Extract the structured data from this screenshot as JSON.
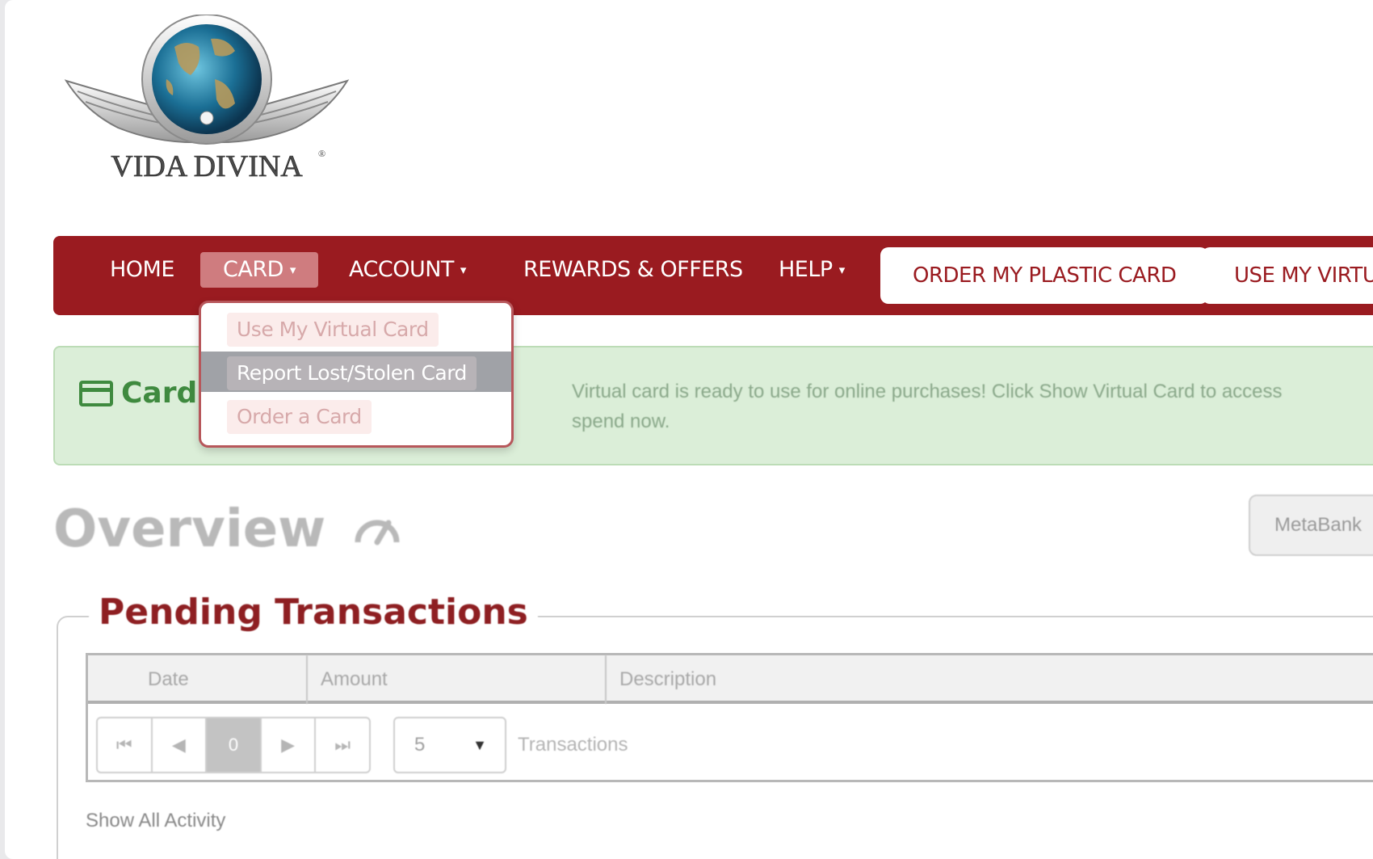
{
  "brand": {
    "name": "VIDA DIVINA",
    "mark": "®"
  },
  "colors": {
    "brand_red": "#9a1b20",
    "alert_green": "#3f8a3f",
    "alert_bg": "#dbeed8"
  },
  "nav": {
    "home": "HOME",
    "card": "CARD",
    "account": "ACCOUNT",
    "rewards": "REWARDS & OFFERS",
    "help": "HELP",
    "caret": "▾",
    "order_plastic": "ORDER MY PLASTIC CARD",
    "use_virtual": "USE MY VIRTUAL CARD"
  },
  "dropdown": {
    "items": [
      {
        "label": "Use My Virtual Card",
        "highlighted": false
      },
      {
        "label": "Report Lost/Stolen Card",
        "highlighted": true
      },
      {
        "label": "Order a Card",
        "highlighted": false
      }
    ]
  },
  "alert": {
    "title": "Card",
    "icon": "credit-card-icon",
    "line1": "Virtual card is ready to use for online purchases! Click Show Virtual Card to access",
    "line2": "spend now."
  },
  "overview": {
    "title": "Overview",
    "icon": "gauge-icon",
    "bank_button": "MetaBank"
  },
  "pending": {
    "title": "Pending Transactions",
    "columns": [
      "Date",
      "Amount",
      "Description"
    ],
    "pager": {
      "first": "⏮",
      "prev": "◀",
      "current": "0",
      "next": "▶",
      "last": "⏭"
    },
    "page_size": "5",
    "page_size_label": "Transactions",
    "show_all": "Show All Activity"
  }
}
